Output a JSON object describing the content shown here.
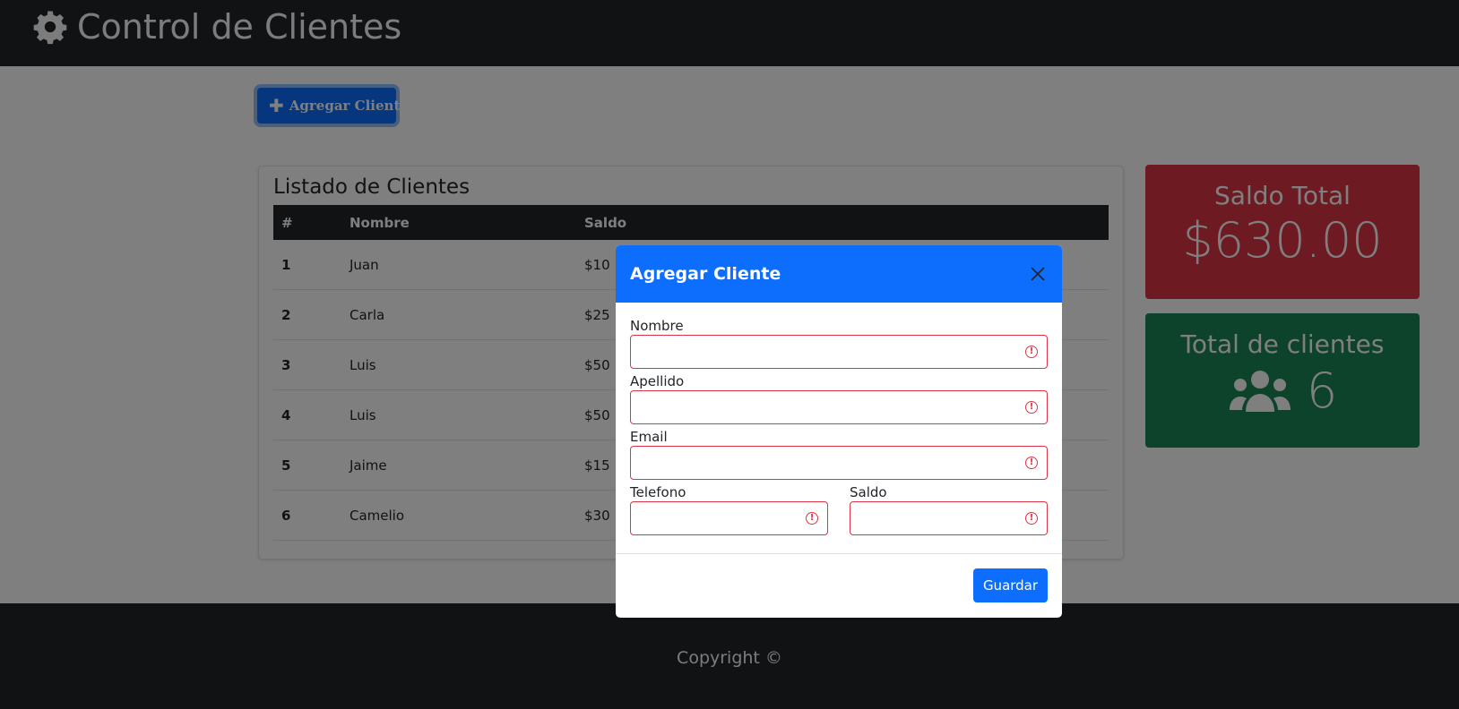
{
  "header": {
    "title": "Control de Clientes",
    "icon": "gear-icon"
  },
  "toolbar": {
    "add_label": "Agregar Cliente",
    "add_icon": "plus-icon"
  },
  "client_list": {
    "title": "Listado de Clientes",
    "columns": [
      "#",
      "Nombre",
      "Saldo"
    ],
    "rows": [
      {
        "num": "1",
        "nombre": "Juan",
        "saldo": "$10"
      },
      {
        "num": "2",
        "nombre": "Carla",
        "saldo": "$25"
      },
      {
        "num": "3",
        "nombre": "Luis",
        "saldo": "$50"
      },
      {
        "num": "4",
        "nombre": "Luis",
        "saldo": "$50"
      },
      {
        "num": "5",
        "nombre": "Jaime",
        "saldo": "$15"
      },
      {
        "num": "6",
        "nombre": "Camelio",
        "saldo": "$30"
      }
    ]
  },
  "summary": {
    "saldo_title": "Saldo Total",
    "saldo_value": "$630.00",
    "clientes_title": "Total de clientes",
    "clientes_value": "6",
    "clientes_icon": "users-icon"
  },
  "footer": {
    "copyright": "Copyright ©"
  },
  "modal": {
    "title": "Agregar Cliente",
    "close_icon": "close-icon",
    "fields": {
      "nombre": {
        "label": "Nombre",
        "value": ""
      },
      "apellido": {
        "label": "Apellido",
        "value": ""
      },
      "email": {
        "label": "Email",
        "value": ""
      },
      "telefono": {
        "label": "Telefono",
        "value": ""
      },
      "saldo": {
        "label": "Saldo",
        "value": ""
      }
    },
    "save_label": "Guardar"
  },
  "colors": {
    "navbar": "#212529",
    "primary": "#0d6efd",
    "danger": "#dc3545",
    "success": "#198754"
  }
}
